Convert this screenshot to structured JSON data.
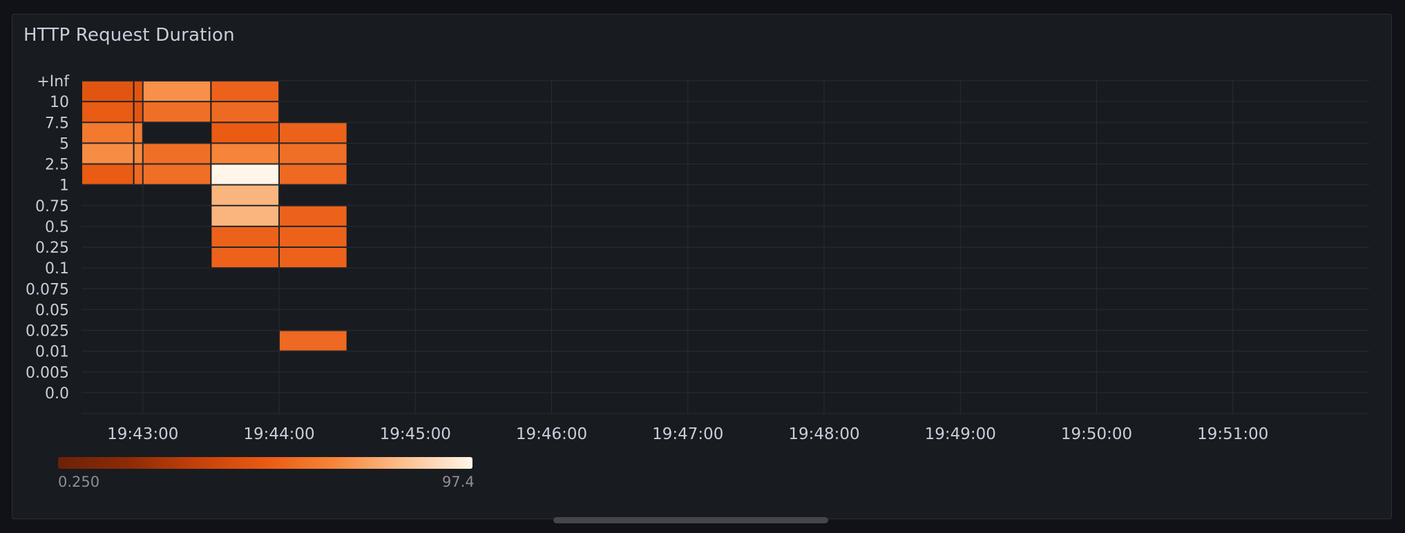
{
  "panel": {
    "title": "HTTP Request Duration"
  },
  "chart_data": {
    "type": "heatmap",
    "title": "HTTP Request Duration",
    "y_buckets": [
      "0.0",
      "0.005",
      "0.01",
      "0.025",
      "0.05",
      "0.075",
      "0.1",
      "0.25",
      "0.5",
      "0.75",
      "1",
      "2.5",
      "5",
      "7.5",
      "10",
      "+Inf"
    ],
    "x_ticks": [
      "19:43:00",
      "19:44:00",
      "19:45:00",
      "19:46:00",
      "19:47:00",
      "19:48:00",
      "19:49:00",
      "19:50:00",
      "19:51:00"
    ],
    "x_range": [
      "19:42:33",
      "19:52:00"
    ],
    "grid": true,
    "color_scale": {
      "min": 0.25,
      "max": 97.4,
      "min_label": "0.250",
      "max_label": "97.4",
      "colors": [
        "#6b2208",
        "#8c2a06",
        "#c3400a",
        "#ea5a13",
        "#f6853a",
        "#fbc08f",
        "#fff5e8"
      ]
    },
    "cells": [
      {
        "t0": "19:42:33",
        "t1": "19:42:56",
        "bucket": "+Inf",
        "value": 4
      },
      {
        "t0": "19:42:56",
        "t1": "19:43:00",
        "bucket": "+Inf",
        "value": 4
      },
      {
        "t0": "19:43:00",
        "t1": "19:43:30",
        "bucket": "+Inf",
        "value": 16
      },
      {
        "t0": "19:43:30",
        "t1": "19:44:00",
        "bucket": "+Inf",
        "value": 6
      },
      {
        "t0": "19:42:33",
        "t1": "19:42:56",
        "bucket": "10",
        "value": 5
      },
      {
        "t0": "19:42:56",
        "t1": "19:43:00",
        "bucket": "10",
        "value": 4
      },
      {
        "t0": "19:43:00",
        "t1": "19:43:30",
        "bucket": "10",
        "value": 8
      },
      {
        "t0": "19:43:30",
        "t1": "19:44:00",
        "bucket": "10",
        "value": 7
      },
      {
        "t0": "19:42:33",
        "t1": "19:42:56",
        "bucket": "7.5",
        "value": 10
      },
      {
        "t0": "19:42:56",
        "t1": "19:43:00",
        "bucket": "7.5",
        "value": 10
      },
      {
        "t0": "19:43:30",
        "t1": "19:44:00",
        "bucket": "7.5",
        "value": 5
      },
      {
        "t0": "19:44:00",
        "t1": "19:44:30",
        "bucket": "7.5",
        "value": 6
      },
      {
        "t0": "19:42:33",
        "t1": "19:42:56",
        "bucket": "5",
        "value": 15
      },
      {
        "t0": "19:42:56",
        "t1": "19:43:00",
        "bucket": "5",
        "value": 14
      },
      {
        "t0": "19:43:00",
        "t1": "19:43:30",
        "bucket": "5",
        "value": 8
      },
      {
        "t0": "19:43:30",
        "t1": "19:44:00",
        "bucket": "5",
        "value": 13
      },
      {
        "t0": "19:44:00",
        "t1": "19:44:30",
        "bucket": "5",
        "value": 8
      },
      {
        "t0": "19:42:33",
        "t1": "19:42:56",
        "bucket": "2.5",
        "value": 5
      },
      {
        "t0": "19:42:56",
        "t1": "19:43:00",
        "bucket": "2.5",
        "value": 7
      },
      {
        "t0": "19:43:00",
        "t1": "19:43:30",
        "bucket": "2.5",
        "value": 8
      },
      {
        "t0": "19:43:30",
        "t1": "19:44:00",
        "bucket": "2.5",
        "value": 97.4
      },
      {
        "t0": "19:44:00",
        "t1": "19:44:30",
        "bucket": "2.5",
        "value": 7
      },
      {
        "t0": "19:43:30",
        "t1": "19:44:00",
        "bucket": "1",
        "value": 30
      },
      {
        "t0": "19:43:30",
        "t1": "19:44:00",
        "bucket": "0.75",
        "value": 30
      },
      {
        "t0": "19:44:00",
        "t1": "19:44:30",
        "bucket": "0.75",
        "value": 6
      },
      {
        "t0": "19:43:30",
        "t1": "19:44:00",
        "bucket": "0.5",
        "value": 6
      },
      {
        "t0": "19:44:00",
        "t1": "19:44:30",
        "bucket": "0.5",
        "value": 6
      },
      {
        "t0": "19:43:30",
        "t1": "19:44:00",
        "bucket": "0.25",
        "value": 6
      },
      {
        "t0": "19:44:00",
        "t1": "19:44:30",
        "bucket": "0.25",
        "value": 6
      },
      {
        "t0": "19:44:00",
        "t1": "19:44:30",
        "bucket": "0.025",
        "value": 7
      }
    ]
  }
}
